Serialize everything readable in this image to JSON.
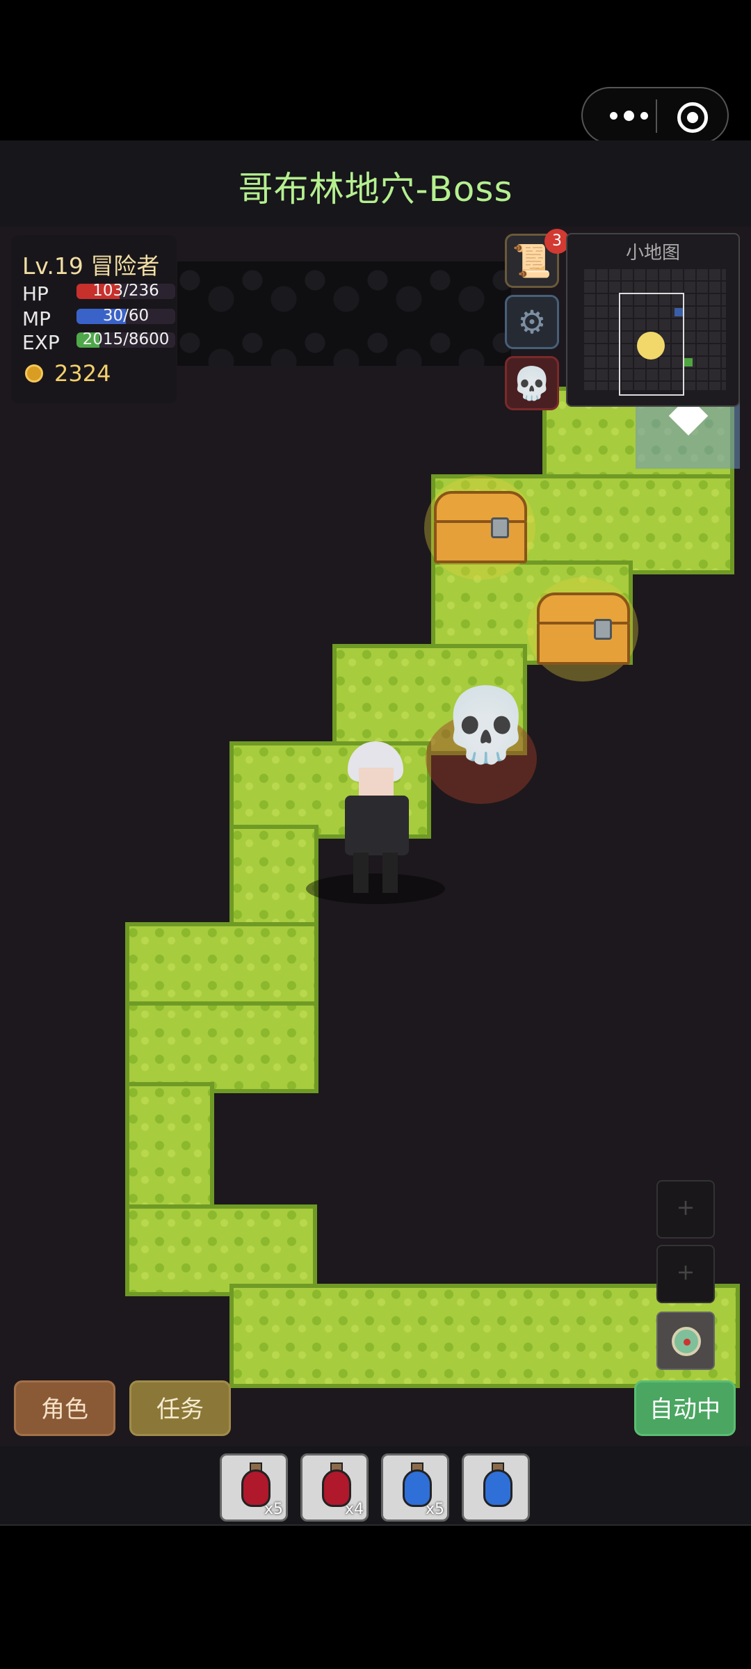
{
  "window": {
    "title": "哥布林地穴-Boss",
    "menu_icon": "more-dots-icon",
    "close_icon": "target-circle-icon"
  },
  "player": {
    "level_text": "Lv.19  冒险者",
    "hp_label": "HP",
    "hp_text": "103/236",
    "hp_fraction": 0.436,
    "mp_label": "MP",
    "mp_text": "30/60",
    "mp_fraction": 0.5,
    "exp_label": "EXP",
    "exp_text": "2015/8600",
    "exp_fraction": 0.234,
    "gold": "2324",
    "colors": {
      "hp": "#c8302c",
      "mp": "#3a63c9",
      "exp": "#4fa84a",
      "gold": "#f3d06d"
    }
  },
  "side_buttons": {
    "quest_log_icon": "scroll-icon",
    "quest_log_badge": "3",
    "settings_icon": "gear-icon",
    "boss_icon": "skull-icon"
  },
  "minimap": {
    "label": "小地图"
  },
  "map_markers": {
    "chest_icon": "treasure-chest-icon",
    "enemy_icon": "skull-icon",
    "exit_icon": "diamond-icon"
  },
  "actions": {
    "role_label": "角色",
    "quest_label": "任务",
    "auto_label": "自动中",
    "slot1_label": "+",
    "slot2_label": "+"
  },
  "items": [
    {
      "name": "red-potion",
      "qty": "x5"
    },
    {
      "name": "red-potion",
      "qty": "x4"
    },
    {
      "name": "blue-potion",
      "qty": "x5"
    },
    {
      "name": "blue-potion",
      "qty": ""
    }
  ]
}
